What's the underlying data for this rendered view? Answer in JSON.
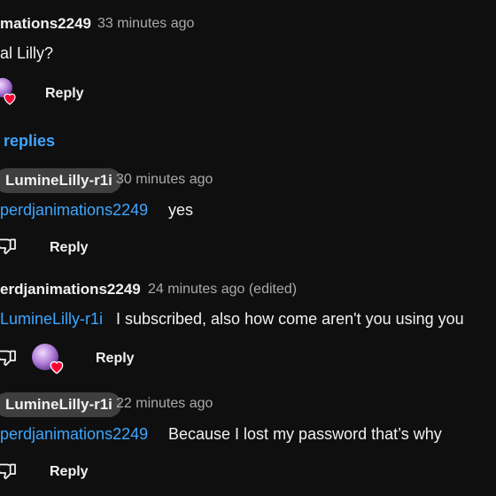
{
  "comment_top": {
    "author": "mations2249",
    "time": "33 minutes ago",
    "text": "al Lilly?",
    "reply_label": "Reply"
  },
  "replies_toggle": {
    "label": "replies"
  },
  "replies": [
    {
      "author": "LumineLilly-r1i",
      "time": "30 minutes ago",
      "mention": "perdjanimations2249",
      "text": "yes",
      "reply_label": "Reply"
    },
    {
      "author": "erdjanimations2249",
      "time": "24 minutes ago (edited)",
      "mention": "LumineLilly-r1i",
      "text": "I subscribed, also how come aren't you using you",
      "reply_label": "Reply"
    },
    {
      "author": "LumineLilly-r1i",
      "time": "22 minutes ago",
      "mention": "perdjanimations2249",
      "text": "Because I lost my password that’s why",
      "reply_label": "Reply"
    }
  ],
  "icons": {
    "dislike": "thumbs-down-icon",
    "creator_heart": "creator-heart-icon"
  },
  "colors": {
    "background": "#0f0f0f",
    "text": "#f1f1f1",
    "meta": "#aaaaaa",
    "link": "#3ea6ff",
    "pill": "#3f3f3f",
    "heart": "#ff0033"
  }
}
